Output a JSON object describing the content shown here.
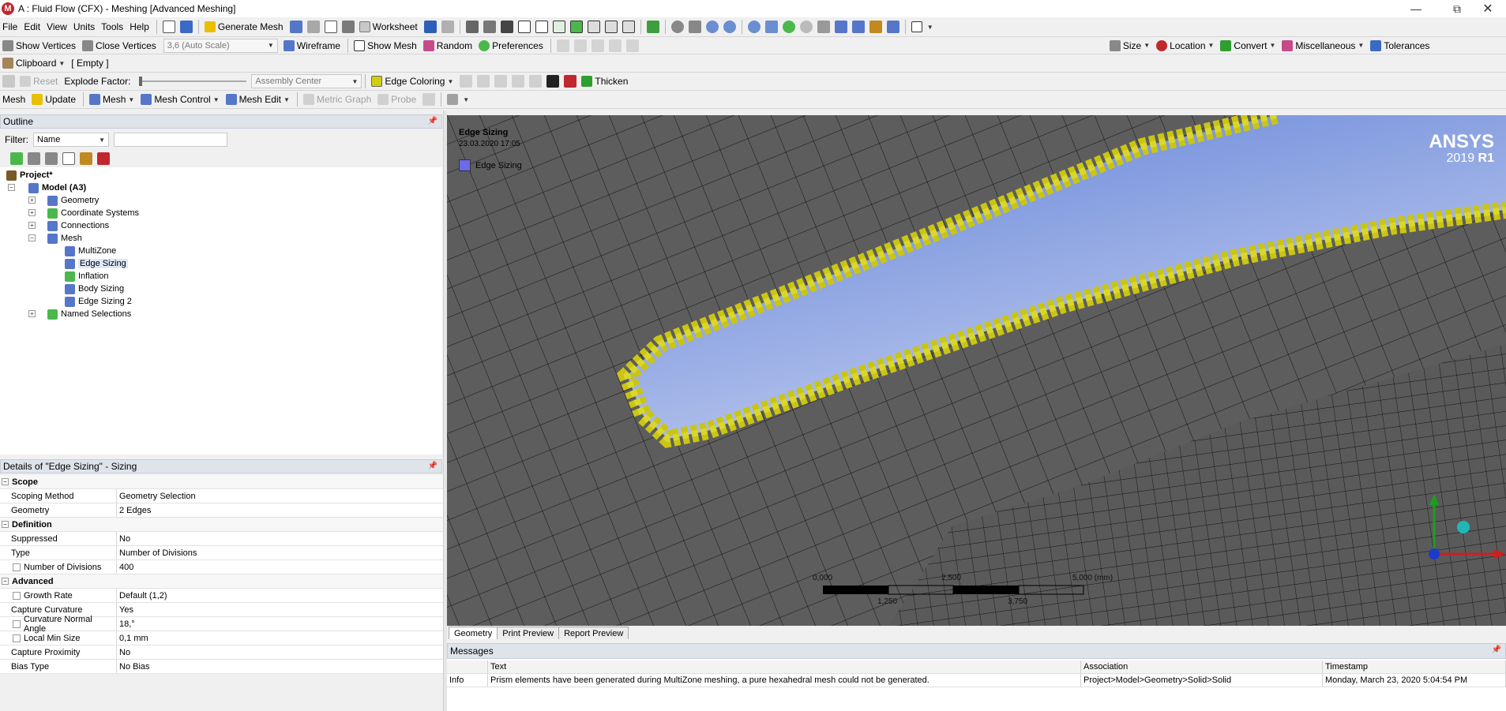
{
  "window": {
    "title": "A : Fluid Flow (CFX) - Meshing [Advanced Meshing]",
    "logo": "M"
  },
  "menu": [
    "File",
    "Edit",
    "View",
    "Units",
    "Tools",
    "Help"
  ],
  "toolbar1": {
    "generate_mesh": "Generate Mesh",
    "worksheet": "Worksheet"
  },
  "toolbar2": {
    "show_vertices": "Show Vertices",
    "close_vertices": "Close Vertices",
    "scale": "3,6 (Auto Scale)",
    "wireframe": "Wireframe",
    "show_mesh": "Show Mesh",
    "random": "Random",
    "preferences": "Preferences",
    "size": "Size",
    "location": "Location",
    "convert": "Convert",
    "miscellaneous": "Miscellaneous",
    "tolerances": "Tolerances"
  },
  "toolbar3": {
    "clipboard": "Clipboard",
    "clipboard_value": "[ Empty ]"
  },
  "toolbar4": {
    "reset": "Reset",
    "explode_factor": "Explode Factor:",
    "assembly_center": "Assembly Center",
    "edge_coloring": "Edge Coloring",
    "thicken": "Thicken"
  },
  "toolbar5": {
    "mesh_label": "Mesh",
    "update": "Update",
    "mesh": "Mesh",
    "mesh_control": "Mesh Control",
    "mesh_edit": "Mesh Edit",
    "metric_graph": "Metric Graph",
    "probe": "Probe"
  },
  "outline": {
    "title": "Outline",
    "filter_label": "Filter:",
    "filter_value": "Name",
    "tree": {
      "project": "Project*",
      "model": "Model (A3)",
      "geometry": "Geometry",
      "coordinate_systems": "Coordinate Systems",
      "connections": "Connections",
      "mesh": "Mesh",
      "multizone": "MultiZone",
      "edge_sizing": "Edge Sizing",
      "inflation": "Inflation",
      "body_sizing": "Body Sizing",
      "edge_sizing_2": "Edge Sizing 2",
      "named_selections": "Named Selections"
    }
  },
  "details": {
    "title": "Details of \"Edge Sizing\" - Sizing",
    "scope": "Scope",
    "scoping_method": "Scoping Method",
    "scoping_method_value": "Geometry Selection",
    "geometry": "Geometry",
    "geometry_value": "2 Edges",
    "definition": "Definition",
    "suppressed": "Suppressed",
    "suppressed_value": "No",
    "type": "Type",
    "type_value": "Number of Divisions",
    "num_divisions": "Number of Divisions",
    "num_divisions_value": "400",
    "advanced": "Advanced",
    "growth_rate": "Growth Rate",
    "growth_rate_value": "Default (1,2)",
    "capture_curvature": "Capture Curvature",
    "capture_curvature_value": "Yes",
    "curvature_normal_angle": "Curvature Normal Angle",
    "curvature_normal_angle_value": "18,°",
    "local_min_size": "Local Min Size",
    "local_min_size_value": "0,1 mm",
    "capture_proximity": "Capture Proximity",
    "capture_proximity_value": "No",
    "bias_type": "Bias Type",
    "bias_type_value": "No Bias"
  },
  "viewport": {
    "annotation_title": "Edge Sizing",
    "annotation_date": "23.03.2020 17:05",
    "legend_label": "Edge Sizing",
    "brand": "ANSYS",
    "version": "2019",
    "release": "R1",
    "scale_0": "0,000",
    "scale_1": "1,250",
    "scale_2": "2,500",
    "scale_3": "3,750",
    "scale_4": "5,000 (mm)"
  },
  "tabs": [
    "Geometry",
    "Print Preview",
    "Report Preview"
  ],
  "messages": {
    "title": "Messages",
    "columns": [
      "Text",
      "Association",
      "Timestamp"
    ],
    "rows": [
      {
        "type": "Info",
        "text": "Prism elements have been generated during MultiZone meshing, a pure hexahedral mesh could not be generated.",
        "association": "Project>Model>Geometry>Solid>Solid",
        "timestamp": "Monday, March 23, 2020 5:04:54 PM"
      }
    ]
  },
  "colors": {
    "accent_blue": "#5b78c8",
    "selection_yellow": "#cfcf10",
    "viewport_bg": "#5b5b5b"
  }
}
